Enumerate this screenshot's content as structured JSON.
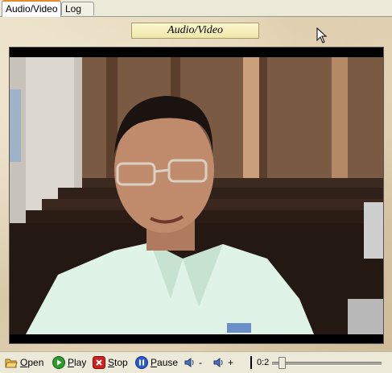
{
  "tabs": [
    {
      "label": "Audio/Video",
      "active": true
    },
    {
      "label": "Log",
      "active": false
    }
  ],
  "section_title": "Audio/Video",
  "controls": {
    "open_label": "Open",
    "play_label": "Play",
    "stop_label": "Stop",
    "pause_label": "Pause",
    "volume_down_label": "-",
    "volume_up_label": "+",
    "time_text": "0:2"
  },
  "icons": {
    "open": "folder-open-icon",
    "play": "play-icon",
    "stop": "stop-icon",
    "pause": "pause-icon",
    "volume_down": "speaker-icon",
    "volume_up": "speaker-icon"
  },
  "colors": {
    "play": "#2c9a2c",
    "stop": "#d02020",
    "pause": "#2a5bd6",
    "tab_active_accent": "#e68b2c",
    "title_bg": "#f5efb8"
  },
  "playback_position": 0.06
}
